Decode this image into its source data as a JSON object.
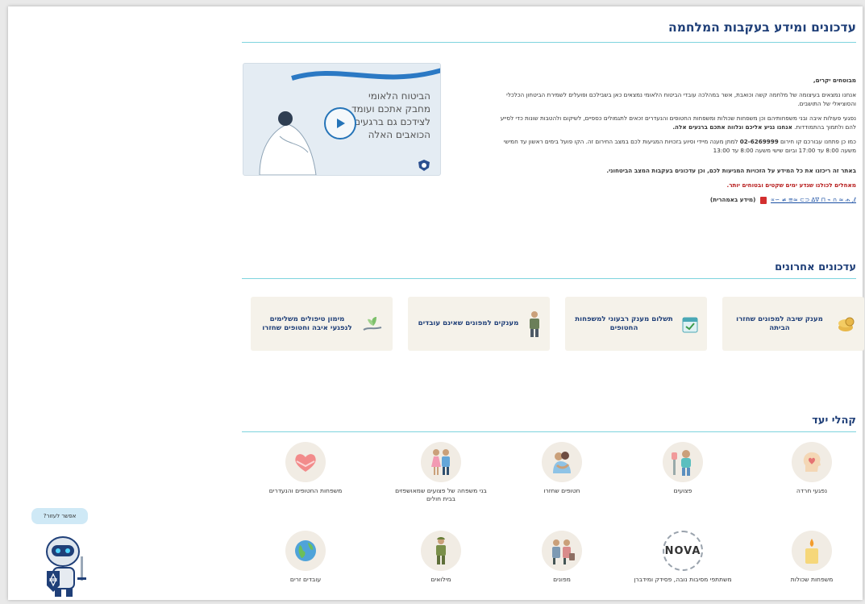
{
  "header": {
    "title": "עדכונים ומידע בעקבות המלחמה"
  },
  "intro": {
    "greeting": "מבוטחים יקרים,",
    "p1": "אנחנו נמצאים בעיצומה של מלחמה קשה וכואבת, אשר במהלכה עובדי הביטוח הלאומי נמצאים כאן בשבילכם ופועלים לשמירת הביטחון הכלכלי והסוציאלי של התושבים.",
    "p2a": "נפגעי פעולות איבה ובני משפחותיהם וכן משפחות שכולות ומשפחות החטופים והנעדרים זכאים לתגמולים כספיים, לשיקום ולהטבות שונות כדי לסייע להם ולתמוך בהתמודדות.",
    "p2b": "אנחנו נגיע אליכם ונלווה אתכם ברגעים אלה.",
    "p3a": "כמו כן פתחנו עבורכם קו חירום",
    "p3phone": "02-6269999",
    "p3b": "למתן מענה מיידי וסיוע בזכויות המגיעות לכם במצב החירום זה. הקו פועל בימים ראשון עד חמישי משעה 8:00 עד 17:00 וביום שישי משעה 8:00 עד 13:00",
    "bold": "באתר זה ריכזנו את כל המידע על הזכויות המגיעות לכם, וכן עדכונים בעקבות המצב הביטחוני.",
    "red": "מאחלים לכולנו שנדע ימים שקטים ובטוחים יותר.",
    "link": "ሐ ,ℓ ≈ ∩ ⌁ ⊓ ∇∆ ⊂⊃ ≈≡ ≠ ∼∝",
    "link_note": "(מידע באמהרית)"
  },
  "video": {
    "text": "הביטוח הלאומי מחבק אתכם ועומד לצידכם גם ברגעים הכואבים האלה",
    "play_icon": "play-icon"
  },
  "recent": {
    "title": "עדכונים אחרונים",
    "cards": [
      {
        "label": "מענק שיבה למפונים שחזרו הביתה",
        "icon": "coins-icon"
      },
      {
        "label": "תשלום מענק רבעוני למשפחות החטופים",
        "icon": "calendar-check-icon"
      },
      {
        "label": "מענקים למפונים שאינם עובדים",
        "icon": "worker-icon"
      },
      {
        "label": "מימון טיפולים משלימים לנפגעי איבה וחטופים שחזרו",
        "icon": "hand-plant-icon"
      }
    ]
  },
  "audiences": {
    "title": "קהלי יעד",
    "items": [
      {
        "label": "נפגעי חרדה",
        "icon": "head-heart-icon"
      },
      {
        "label": "פצועים",
        "icon": "injured-icon"
      },
      {
        "label": "חטופים שחזרו",
        "icon": "hug-icon"
      },
      {
        "label": "בני משפחה של פצועים שמאושפזים בבית חולים",
        "icon": "family-icon"
      },
      {
        "label": "משפחות החטופים והנעדרים",
        "icon": "heart-hands-icon"
      },
      {
        "label": "משפחות שכולות",
        "icon": "candle-icon"
      },
      {
        "label": "משתתפי מסיבות נובה, פסידק ומידברן",
        "icon": "nova-icon",
        "badge": "NOVA"
      },
      {
        "label": "מפונים",
        "icon": "evacuees-icon"
      },
      {
        "label": "מילואים",
        "icon": "soldier-icon"
      },
      {
        "label": "עובדים זרים",
        "icon": "globe-icon"
      }
    ]
  },
  "assistant": {
    "bubble": "אפשר לעזור?"
  }
}
